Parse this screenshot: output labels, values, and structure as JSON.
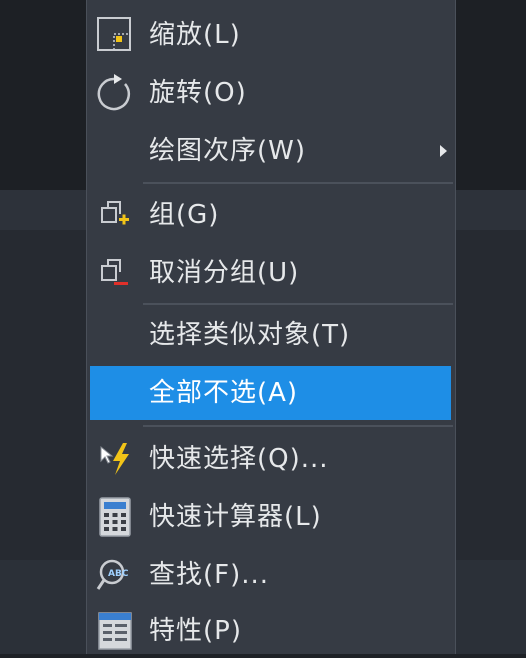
{
  "menu": {
    "items": [
      {
        "label": "缩放(L)",
        "icon": "zoom-icon"
      },
      {
        "label": "旋转(O)",
        "icon": "rotate-icon"
      },
      {
        "label": "绘图次序(W)",
        "icon": "",
        "submenu": true
      },
      {
        "label": "组(G)",
        "icon": "group-icon"
      },
      {
        "label": "取消分组(U)",
        "icon": "ungroup-icon"
      },
      {
        "label": "选择类似对象(T)",
        "icon": ""
      },
      {
        "label": "全部不选(A)",
        "icon": "",
        "active": true
      },
      {
        "label": "快速选择(Q)...",
        "icon": "quick-select-icon"
      },
      {
        "label": "快速计算器(L)",
        "icon": "calculator-icon"
      },
      {
        "label": "查找(F)...",
        "icon": "find-icon"
      },
      {
        "label": "特性(P)",
        "icon": "properties-icon"
      }
    ]
  },
  "colors": {
    "menu_bg": "#363b44",
    "highlight": "#1e8ee6",
    "text": "#e6e8ea",
    "icon_yellow": "#f2c418",
    "icon_red": "#e0302a"
  }
}
